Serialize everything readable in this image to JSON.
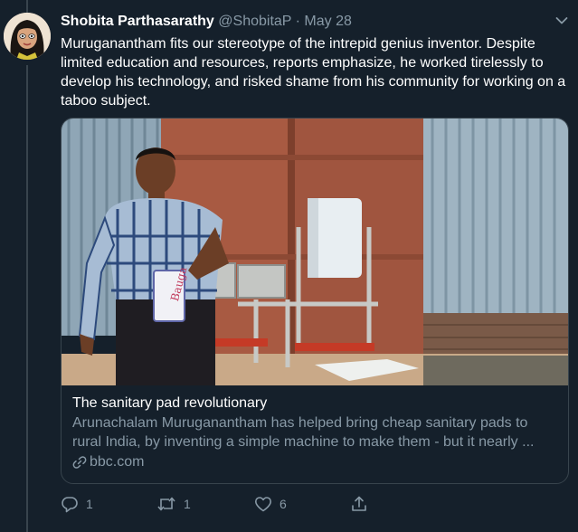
{
  "tweet": {
    "author_name": "Shobita Parthasarathy",
    "handle": "@ShobitaP",
    "separator": "·",
    "date": "May 28",
    "text": "Muruganantham fits our stereotype of the intrepid genius inventor. Despite limited education and resources, reports emphasize, he worked tirelessly to develop his technology, and risked shame from his community for working on a taboo subject."
  },
  "card": {
    "title": "The sanitary pad revolutionary",
    "description": "Arunachalam Muruganantham has helped bring cheap sanitary pads to rural India, by inventing a simple machine to make them - but it nearly ...",
    "domain": "bbc.com",
    "image_package_text": "Bauga"
  },
  "actions": {
    "reply_count": "1",
    "retweet_count": "1",
    "like_count": "6"
  },
  "colors": {
    "background": "#15202b",
    "border": "#38444d",
    "secondary_text": "#8899a6",
    "primary_text": "#ffffff"
  },
  "icons": [
    "caret-down-icon",
    "link-icon",
    "reply-icon",
    "retweet-icon",
    "like-icon",
    "share-icon"
  ]
}
